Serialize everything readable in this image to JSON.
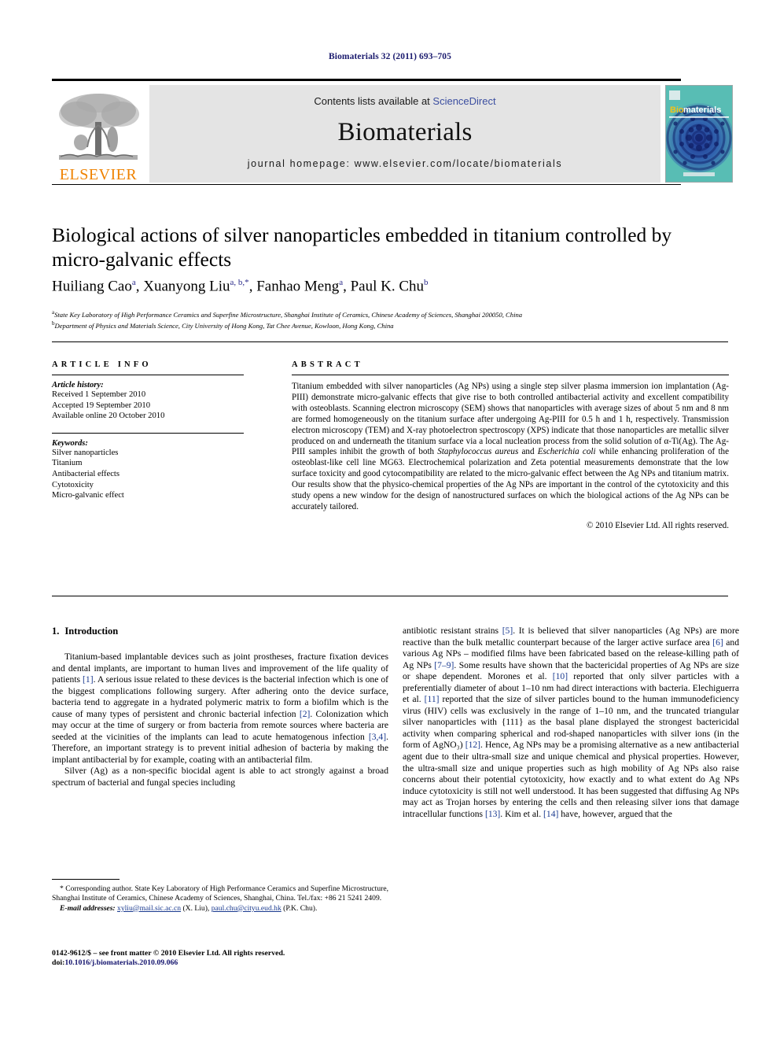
{
  "running_head": "Biomaterials 32 (2011) 693–705",
  "masthead": {
    "contents_prefix": "Contents lists available at ",
    "sciencedirect": "ScienceDirect",
    "journal_name": "Biomaterials",
    "homepage": "journal homepage: www.elsevier.com/locate/biomaterials",
    "publisher": "ELSEVIER",
    "cover_title_bio": "Bio",
    "cover_title_materials": "materials",
    "colors": {
      "elsevier_orange": "#ef8200",
      "sciencedirect_blue": "#3b4ea0",
      "panel_grey": "#e4e4e4",
      "cover_teal": "#4fb3ae",
      "cover_dark_blue": "#1d2f8f",
      "link_blue": "#1a3a8f"
    }
  },
  "article": {
    "title": "Biological actions of silver nanoparticles embedded in titanium controlled by micro-galvanic effects",
    "authors": [
      {
        "name": "Huiliang Cao",
        "marks": "a"
      },
      {
        "name": "Xuanyong Liu",
        "marks": "a, b,*"
      },
      {
        "name": "Fanhao Meng",
        "marks": "a"
      },
      {
        "name": "Paul K. Chu",
        "marks": "b"
      }
    ],
    "affiliations": [
      {
        "mark": "a",
        "text": "State Key Laboratory of High Performance Ceramics and Superfine Microstructure, Shanghai Institute of Ceramics, Chinese Academy of Sciences, Shanghai 200050, China"
      },
      {
        "mark": "b",
        "text": "Department of Physics and Materials Science, City University of Hong Kong, Tat Chee Avenue, Kowloon, Hong Kong, China"
      }
    ]
  },
  "article_info": {
    "heading": "ARTICLE INFO",
    "history_label": "Article history:",
    "history": [
      "Received 1 September 2010",
      "Accepted 19 September 2010",
      "Available online 20 October 2010"
    ],
    "keywords_label": "Keywords:",
    "keywords": [
      "Silver nanoparticles",
      "Titanium",
      "Antibacterial effects",
      "Cytotoxicity",
      "Micro-galvanic effect"
    ]
  },
  "abstract": {
    "heading": "ABSTRACT",
    "part1": "Titanium embedded with silver nanoparticles (Ag NPs) using a single step silver plasma immersion ion implantation (Ag-PIII) demonstrate micro-galvanic effects that give rise to both controlled antibacterial activity and excellent compatibility with osteoblasts. Scanning electron microscopy (SEM) shows that nanoparticles with average sizes of about 5 nm and 8 nm are formed homogeneously on the titanium surface after undergoing Ag-PIII for 0.5 h and 1 h, respectively. Transmission electron microscopy (TEM) and X-ray photoelectron spectroscopy (XPS) indicate that those nanoparticles are metallic silver produced on and underneath the titanium surface via a local nucleation process from the solid solution of α-Ti(Ag). The Ag-PIII samples inhibit the growth of both ",
    "italic1": "Staphylococcus aureus",
    "part2": " and ",
    "italic2": "Escherichia coli",
    "part3": " while enhancing proliferation of the osteoblast-like cell line MG63. Electrochemical polarization and Zeta potential measurements demonstrate that the low surface toxicity and good cytocompatibility are related to the micro-galvanic effect between the Ag NPs and titanium matrix. Our results show that the physico-chemical properties of the Ag NPs are important in the control of the cytotoxicity and this study opens a new window for the design of nanostructured surfaces on which the biological actions of the Ag NPs can be accurately tailored.",
    "copyright": "© 2010 Elsevier Ltd. All rights reserved."
  },
  "body": {
    "section_number": "1.",
    "section_title": "Introduction",
    "left_paragraphs": [
      {
        "segments": [
          {
            "t": "Titanium-based implantable devices such as joint prostheses, fracture fixation devices and dental implants, are important to human lives and improvement of the life quality of patients "
          },
          {
            "t": "[1]",
            "ref": true
          },
          {
            "t": ". A serious issue related to these devices is the bacterial infection which is one of the biggest complications following surgery. After adhering onto the device surface, bacteria tend to aggregate in a hydrated polymeric matrix to form a biofilm which is the cause of many types of persistent and chronic bacterial infection "
          },
          {
            "t": "[2]",
            "ref": true
          },
          {
            "t": ". Colonization which may occur at the time of surgery or from bacteria from remote sources where bacteria are seeded at the vicinities of the implants can lead to acute hematogenous infection "
          },
          {
            "t": "[3,4]",
            "ref": true
          },
          {
            "t": ". Therefore, an important strategy is to prevent initial adhesion of bacteria by making the implant antibacterial by for example, coating with an antibacterial film."
          }
        ]
      },
      {
        "segments": [
          {
            "t": "Silver (Ag) as a non-specific biocidal agent is able to act strongly against a broad spectrum of bacterial and fungal species including"
          }
        ]
      }
    ],
    "right_paragraphs": [
      {
        "segments": [
          {
            "t": "antibiotic resistant strains "
          },
          {
            "t": "[5]",
            "ref": true
          },
          {
            "t": ". It is believed that silver nanoparticles (Ag NPs) are more reactive than the bulk metallic counterpart because of the larger active surface area "
          },
          {
            "t": "[6]",
            "ref": true
          },
          {
            "t": " and various Ag NPs – modified films have been fabricated based on the release-killing path of Ag NPs "
          },
          {
            "t": "[7–9]",
            "ref": true
          },
          {
            "t": ". Some results have shown that the bactericidal properties of Ag NPs are size or shape dependent. Morones et al. "
          },
          {
            "t": "[10]",
            "ref": true
          },
          {
            "t": " reported that only silver particles with a preferentially diameter of about 1–10 nm had direct interactions with bacteria. Elechiguerra et al. "
          },
          {
            "t": "[11]",
            "ref": true
          },
          {
            "t": " reported that the size of silver particles bound to the human immunodeficiency virus (HIV) cells was exclusively in the range of 1–10 nm, and the truncated triangular silver nanoparticles with {111} as the basal plane displayed the strongest bactericidal activity when comparing spherical and rod-shaped nanoparticles with silver ions (in the form of AgNO₃) "
          },
          {
            "t": "[12]",
            "ref": true
          },
          {
            "t": ". Hence, Ag NPs may be a promising alternative as a new antibacterial agent due to their ultra-small size and unique chemical and physical properties. However, the ultra-small size and unique properties such as high mobility of Ag NPs also raise concerns about their potential cytotoxicity, how exactly and to what extent do Ag NPs induce cytotoxicity is still not well understood. It has been suggested that diffusing Ag NPs may act as Trojan horses by entering the cells and then releasing silver ions that damage intracellular functions "
          },
          {
            "t": "[13]",
            "ref": true
          },
          {
            "t": ". Kim et al. "
          },
          {
            "t": "[14]",
            "ref": true
          },
          {
            "t": " have, however, argued that the"
          }
        ]
      }
    ]
  },
  "footnote": {
    "line1": "* Corresponding author. State Key Laboratory of High Performance Ceramics and Superfine Microstructure, Shanghai Institute of Ceramics, Chinese Academy of Sciences, Shanghai, China. Tel./fax: +86 21 5241 2409.",
    "email_label": "E-mail addresses:",
    "email1": "xyliu@mail.sic.ac.cn",
    "email1_owner": "(X. Liu),",
    "email2": "paul.chu@cityu.eud.hk",
    "email2_owner": "(P.K. Chu)."
  },
  "colophon": {
    "line1": "0142-9612/$ – see front matter © 2010 Elsevier Ltd. All rights reserved.",
    "doi_label": "doi:",
    "doi": "10.1016/j.biomaterials.2010.09.066"
  }
}
